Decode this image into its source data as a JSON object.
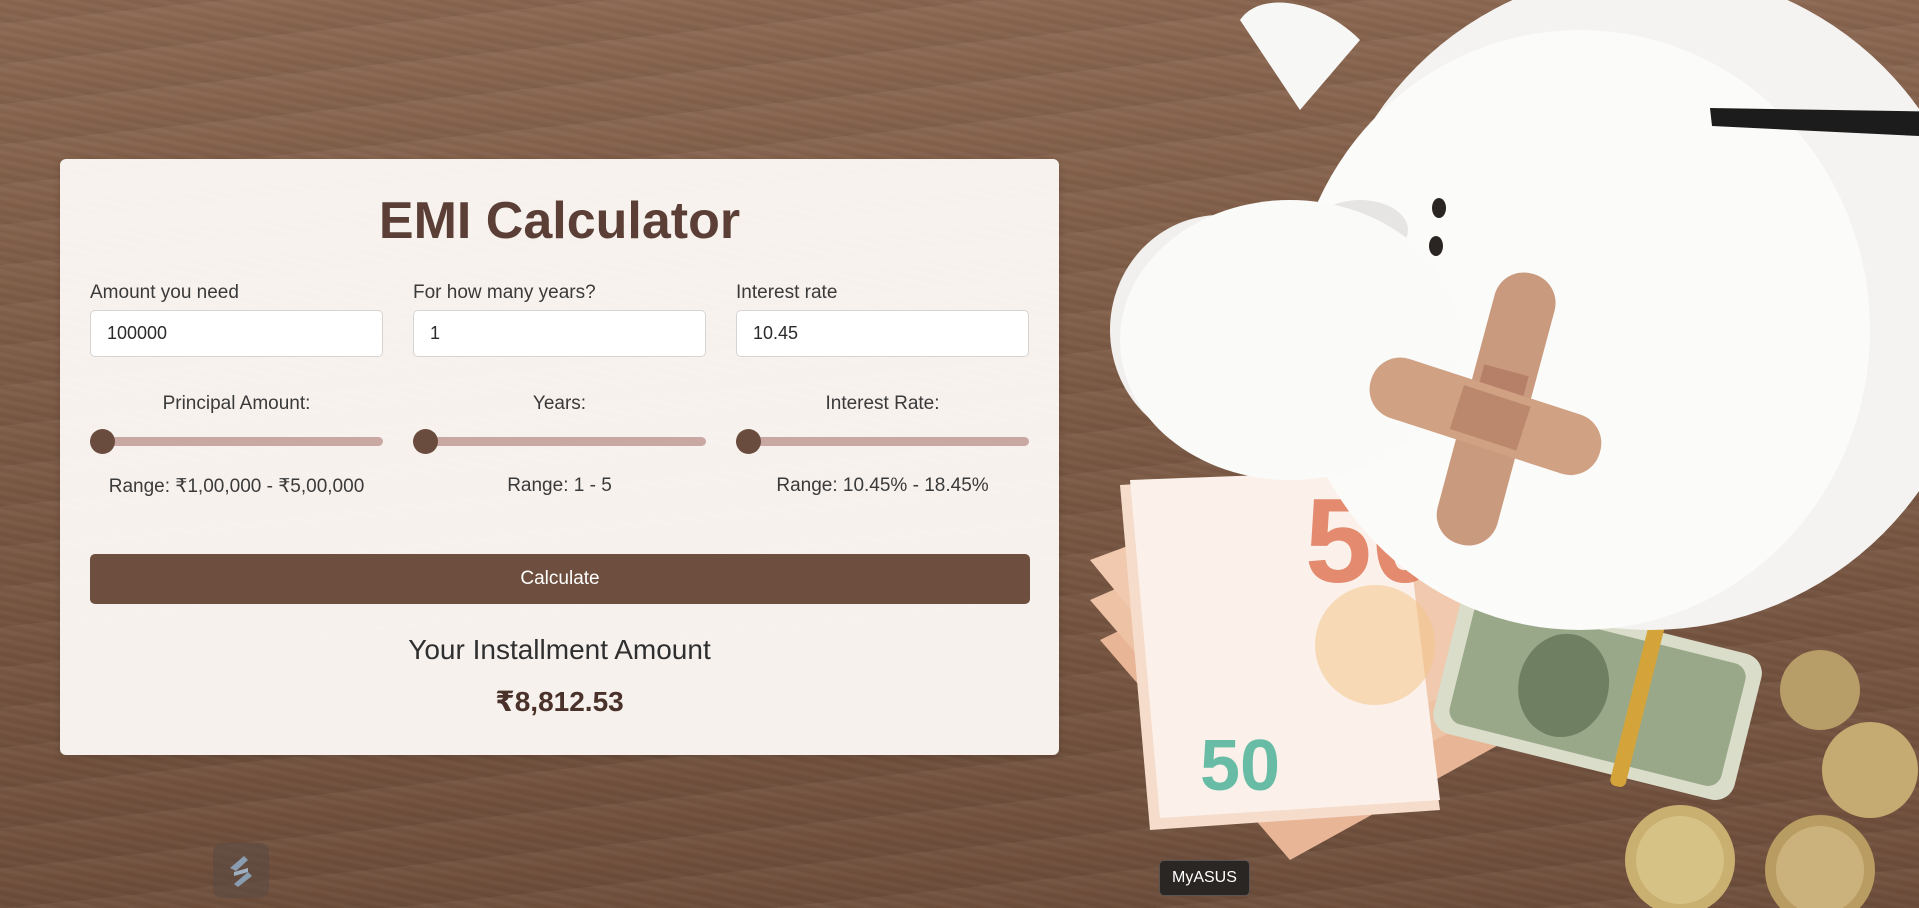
{
  "calculator": {
    "title": "EMI Calculator",
    "fields": {
      "amount": {
        "label": "Amount you need",
        "value": "100000"
      },
      "years": {
        "label": "For how many years?",
        "value": "1"
      },
      "interest": {
        "label": "Interest rate",
        "value": "10.45"
      }
    },
    "sliders": {
      "principal": {
        "label": "Principal Amount:",
        "range_text": "Range: ₹1,00,000 - ₹5,00,000",
        "min": 100000,
        "max": 500000,
        "value": 100000
      },
      "years": {
        "label": "Years:",
        "range_text": "Range: 1 - 5",
        "min": 1,
        "max": 5,
        "value": 1
      },
      "interest": {
        "label": "Interest Rate:",
        "range_text": "Range: 10.45% - 18.45%",
        "min": 10.45,
        "max": 18.45,
        "value": 10.45
      }
    },
    "calculate_label": "Calculate",
    "result": {
      "heading": "Your Installment Amount",
      "value": "₹8,812.53"
    }
  },
  "tooltip": {
    "text": "MyASUS"
  },
  "colors": {
    "accent": "#6e4e3e",
    "title": "#5b3f36",
    "track": "#c9a8a4",
    "thumb": "#6a4c3e"
  },
  "icons": {
    "app_badge": "app-logo-icon"
  }
}
